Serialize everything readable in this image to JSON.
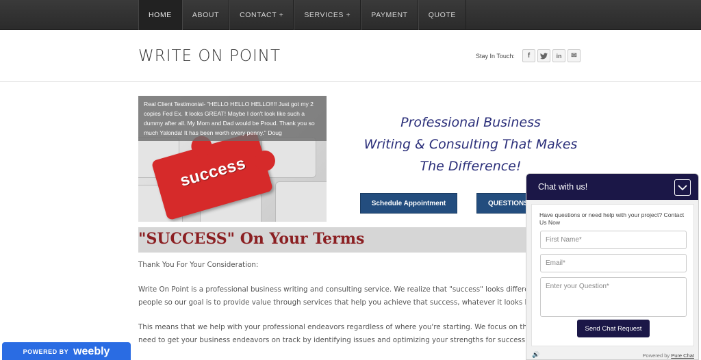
{
  "nav": {
    "items": [
      {
        "label": "HOME"
      },
      {
        "label": "ABOUT"
      },
      {
        "label": "CONTACT +"
      },
      {
        "label": "SERVICES +"
      },
      {
        "label": "PAYMENT"
      },
      {
        "label": "QUOTE"
      }
    ],
    "active_index": 0
  },
  "header": {
    "site_title": "WRITE ON POINT",
    "stay_in_touch": "Stay In Touch:",
    "social": [
      {
        "glyph": "f",
        "icon": "facebook-icon"
      },
      {
        "glyph": "t",
        "icon": "twitter-icon"
      },
      {
        "glyph": "in",
        "icon": "linkedin-icon"
      },
      {
        "glyph": "✉",
        "icon": "mail-icon"
      }
    ]
  },
  "hero": {
    "caption": "Real Client Testimonial- \"HELLO HELLO HELLO!!!! Just got my 2 copies Fed Ex. It looks GREAT! Maybe I don't look like such a dummy after all. My Mom and Dad would be Proud. Thank you so much Yalonda! It has been worth every penny.\" Doug",
    "image_word": "success"
  },
  "headline": {
    "line1": "Professional Business",
    "line2": "Writing & Consulting That Makes",
    "line3": "The Difference!"
  },
  "buttons": {
    "schedule": "Schedule Appointment",
    "questions": "QUESTIONS?"
  },
  "section": {
    "title": "\"SUCCESS\" On Your Terms",
    "thank_you": "Thank You For Your Consideration:",
    "para1_line1": "Write On Point is a professional business writing and consulting service. We realize that \"success\" looks different fo",
    "para1_line2": "people so our goal is to provide value through services that help you achieve that success, whatever it looks like.",
    "para2_line1": "This means that we help with your professional endeavors regardless of where you're starting. We focus on the th",
    "para2_line2": "need to get your business endeavors on track by identifying issues and optimizing your strengths for success."
  },
  "footer_badge": {
    "powered_by": "POWERED BY",
    "brand": "weebly"
  },
  "chat": {
    "title": "Chat with us!",
    "intro": "Have questions or need help with your project? Contact Us Now",
    "first_name_placeholder": "First Name*",
    "email_placeholder": "Email*",
    "question_placeholder": "Enter your Question*",
    "send_label": "Send Chat Request",
    "powered_by": "Powered by",
    "powered_brand": "Pure Chat"
  },
  "colors": {
    "nav_bg": "#2e2e2e",
    "headline": "#2b2f7a",
    "button": "#234d7e",
    "section_title": "#8b1f22",
    "chat_header": "#1b1747",
    "weebly": "#2a6ce3"
  }
}
